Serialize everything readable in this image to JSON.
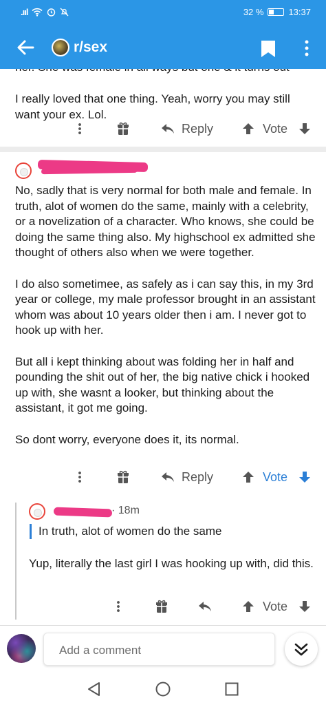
{
  "status_bar": {
    "signal": ".ııl",
    "battery_text": "32 %",
    "battery_level": 0.32,
    "time": "13:37"
  },
  "app_bar": {
    "subreddit": "r/sex",
    "icons": [
      "back-arrow-icon",
      "subreddit-avatar",
      "bookmark-icon",
      "more-vert-icon"
    ]
  },
  "comments": [
    {
      "clipped_line": "her. She was female in all ways but one & it turns out",
      "paragraphs": [
        "I really loved that one thing. Yeah, worry you may still want your ex. Lol."
      ],
      "actions": {
        "reply": "Reply",
        "vote": "Vote",
        "voted": false
      }
    },
    {
      "paragraphs": [
        "No, sadly that is very normal for both male and female. In truth, alot of women do the same, mainly with a celebrity, or a novelization of a character. Who knows, she could be doing the same thing also. My highschool ex admitted she thought of others also when we were together.",
        "I do also sometimee, as safely as i can say this, in my 3rd year or college, my male professor brought in an assistant whom was about 10 years older then i am. I never got to hook up with her.",
        "But all i kept thinking about was folding her in half and pounding the shit out of her, the big native chick i hooked up with, she wasnt a looker, but thinking about the assistant, it got me going.",
        "So dont worry, everyone does it, its normal."
      ],
      "actions": {
        "reply": "Reply",
        "vote": "Vote",
        "voted": true
      }
    },
    {
      "age": "18m",
      "quote": "In truth, alot of women do the same",
      "paragraphs": [
        "Yup, literally the last girl I was hooking up with, did this."
      ],
      "actions": {
        "vote": "Vote",
        "voted": false
      }
    }
  ],
  "composer": {
    "placeholder": "Add a comment"
  },
  "colors": {
    "brand": "#2b96e6",
    "upvoted": "#2b7fd6",
    "redaction": "#ec3a86",
    "divider": "#ececec"
  }
}
